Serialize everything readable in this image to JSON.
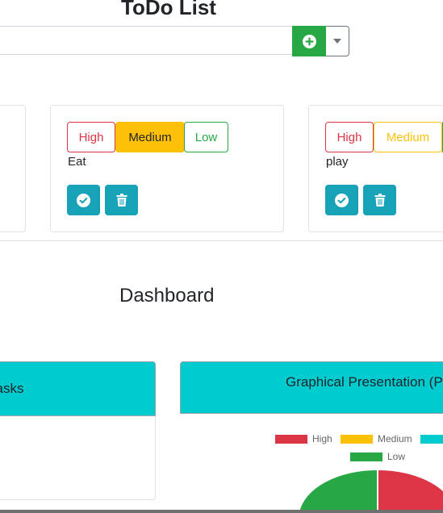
{
  "app": {
    "title": "ToDo List"
  },
  "toolbar": {
    "search_placeholder": "",
    "add_icon": "plus-circle-icon",
    "dropdown_icon": "caret-down-icon"
  },
  "priority_labels": {
    "high": "High",
    "medium": "Medium",
    "low": "Low"
  },
  "tasks": [
    {
      "name": "Eat",
      "priority": "Medium"
    },
    {
      "name": "play",
      "priority": ""
    }
  ],
  "dashboard": {
    "title": "Dashboard",
    "tasks_panel": {
      "title": "Tasks"
    },
    "graph_panel": {
      "title": "Graphical Presentation (P"
    }
  },
  "chart_data": {
    "type": "pie",
    "legend": [
      "High",
      "Medium",
      "Low"
    ],
    "legend_placement": "top",
    "colors": {
      "High": "#dc3545",
      "Medium": "#ffc107",
      "Low": "#28a745",
      "fourth": "#00ccd0"
    }
  },
  "colors": {
    "accent": "#17a2b8",
    "success": "#28a745",
    "warning": "#ffc107",
    "danger": "#dc3545",
    "cyan": "#00ccd0"
  }
}
